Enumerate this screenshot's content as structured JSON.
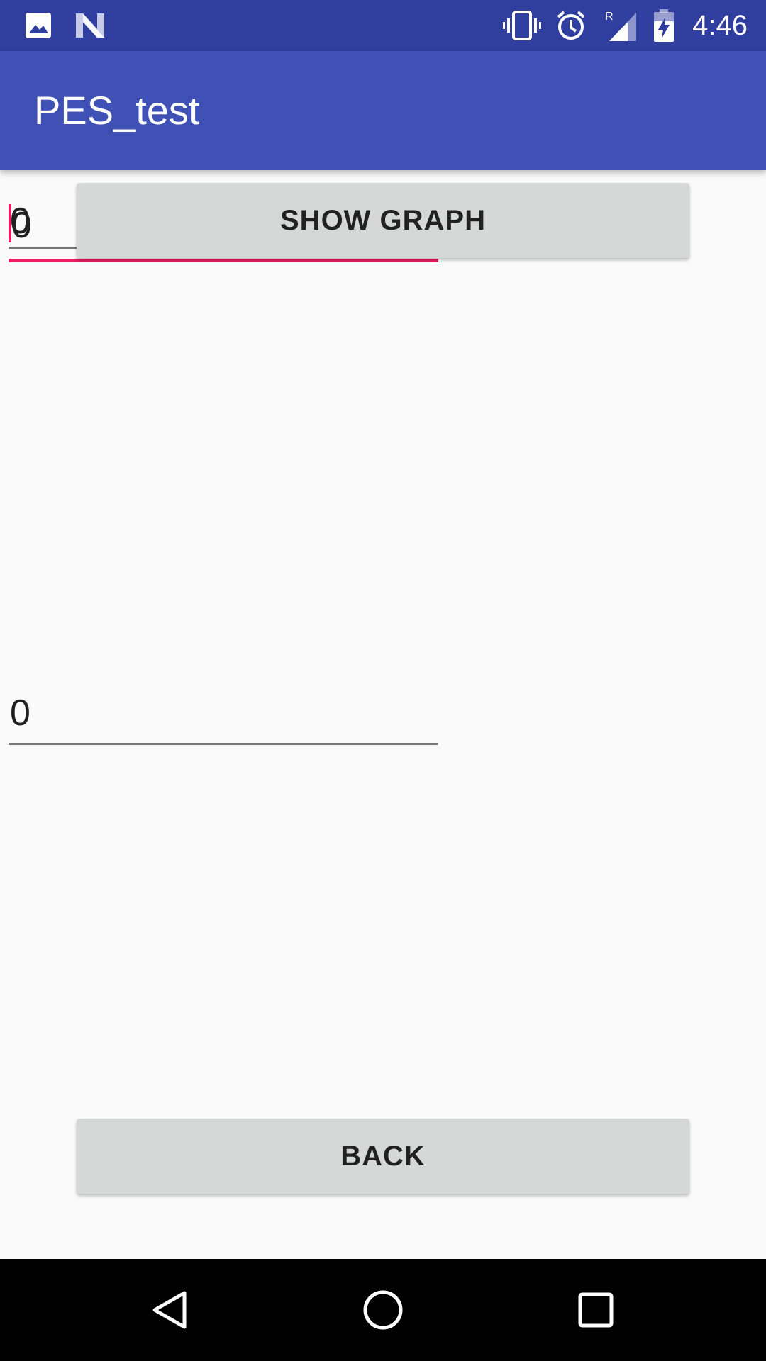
{
  "status_bar": {
    "time": "4:46",
    "icons": [
      "image-icon",
      "n-logo-icon",
      "vibrate-icon",
      "alarm-icon",
      "signal-icon",
      "battery-charging-icon"
    ],
    "signal_label": "R"
  },
  "app_bar": {
    "title": "PES_test"
  },
  "fields": {
    "top_value": "0",
    "top_overlap_value": "0",
    "bottom_value": "0"
  },
  "buttons": {
    "show_graph": "SHOW GRAPH",
    "back": "BACK"
  },
  "nav_bar": {
    "icons": [
      "back-icon",
      "home-icon",
      "recents-icon"
    ]
  },
  "colors": {
    "status_bar": "#303f9f",
    "app_bar": "#3f51b5",
    "accent": "#e91e63",
    "background": "#fafafa",
    "button": "#d6d7d7"
  }
}
